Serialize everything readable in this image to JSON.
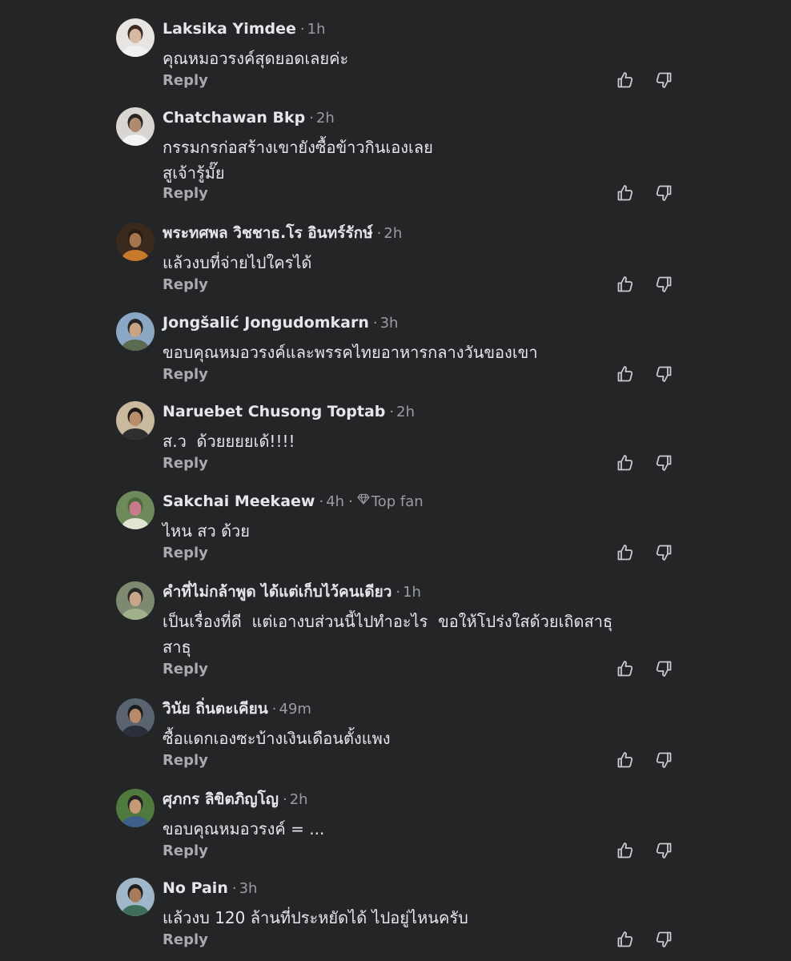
{
  "comments": [
    {
      "author": "Laksika Yimdee",
      "separator": "·",
      "time": "1h",
      "text": "คุณหมอวรงค์สุดยอดเลยค่ะ",
      "reply_label": "Reply",
      "avatar": {
        "bg": "#e8e4e2",
        "face": "#d9b9a4",
        "hair": "#3a2a22",
        "shirt": "#f1f1f1"
      }
    },
    {
      "author": "Chatchawan Bkp",
      "separator": "·",
      "time": "2h",
      "text": "กรรมกรก่อสร้างเขายังซื้อข้าวกินเองเลย\nสูเจ้ารู้มั๊ย",
      "reply_label": "Reply",
      "avatar": {
        "bg": "#d9d6d2",
        "face": "#b08a6e",
        "hair": "#2a2420",
        "shirt": "#f4f4f4"
      }
    },
    {
      "author": "พระทศพล วิชชาธ.โร อินทร์รักษ์",
      "separator": "·",
      "time": "2h",
      "text": "แล้วงบที่จ่ายไปใครได้",
      "reply_label": "Reply",
      "avatar": {
        "bg": "#3a2a1e",
        "face": "#a5764e",
        "hair": "#2b1d14",
        "shirt": "#c77b2a"
      }
    },
    {
      "author": "Jongšalić Jongudomkarn",
      "separator": "·",
      "time": "3h",
      "text": "ขอบคุณหมอวรงค์และพรรคไทยอาหารกลางวันของเขา",
      "reply_label": "Reply",
      "avatar": {
        "bg": "#8aa7c4",
        "face": "#c9a383",
        "hair": "#262626",
        "shirt": "#5a6b52"
      }
    },
    {
      "author": "Naruebet Chusong Toptab",
      "separator": "·",
      "time": "2h",
      "text": "ส.ว  ด้วยยยยเด้!!!!",
      "reply_label": "Reply",
      "avatar": {
        "bg": "#c9b99e",
        "face": "#b98e6c",
        "hair": "#1f1a17",
        "shirt": "#2f2f2f"
      }
    },
    {
      "author": "Sakchai Meekaew",
      "separator": "·",
      "time": "4h",
      "badge": "Top fan",
      "text": "ไหน สว ด้วย",
      "reply_label": "Reply",
      "avatar": {
        "bg": "#6f8a5a",
        "face": "#c97a8a",
        "hair": "#4d6b3c",
        "shirt": "#e0e6d2"
      }
    },
    {
      "author": "คำที่ไม่กล้าพูด ได้แต่เก็บไว้คนเดียว",
      "separator": "·",
      "time": "1h",
      "text": "เป็นเรื่องที่ดี  แต่เอางบส่วนนี้ไปทำอะไร  ขอให้โปร่งใสด้วยเถิดสาธุ\nสาธุ",
      "reply_label": "Reply",
      "avatar": {
        "bg": "#7d8a70",
        "face": "#c8a68a",
        "hair": "#2c2a26",
        "shirt": "#9fb08a"
      }
    },
    {
      "author": "วินัย ถิ่นตะเคียน",
      "separator": "·",
      "time": "49m",
      "text": "ซื้อแดกเองซะบ้างเงินเดือนตั้งแพง",
      "reply_label": "Reply",
      "avatar": {
        "bg": "#5a6470",
        "face": "#b88b6a",
        "hair": "#1c1c1c",
        "shirt": "#2a2f3a"
      }
    },
    {
      "author": "ศุภกร ลิขิตภิญโญ",
      "separator": "·",
      "time": "2h",
      "text": "ขอบคุณหมอวรงค์ = ...",
      "reply_label": "Reply",
      "avatar": {
        "bg": "#4f7a3e",
        "face": "#c49a76",
        "hair": "#222222",
        "shirt": "#3d5f8a"
      }
    },
    {
      "author": "No Pain",
      "separator": "·",
      "time": "3h",
      "text": "แล้วงบ 120 ล้านที่ประหยัดได้ ไปอยู่ไหนครับ",
      "reply_label": "Reply",
      "avatar": {
        "bg": "#9fb7c9",
        "face": "#a87c5a",
        "hair": "#1e1e1e",
        "shirt": "#3f6f5a"
      }
    }
  ]
}
